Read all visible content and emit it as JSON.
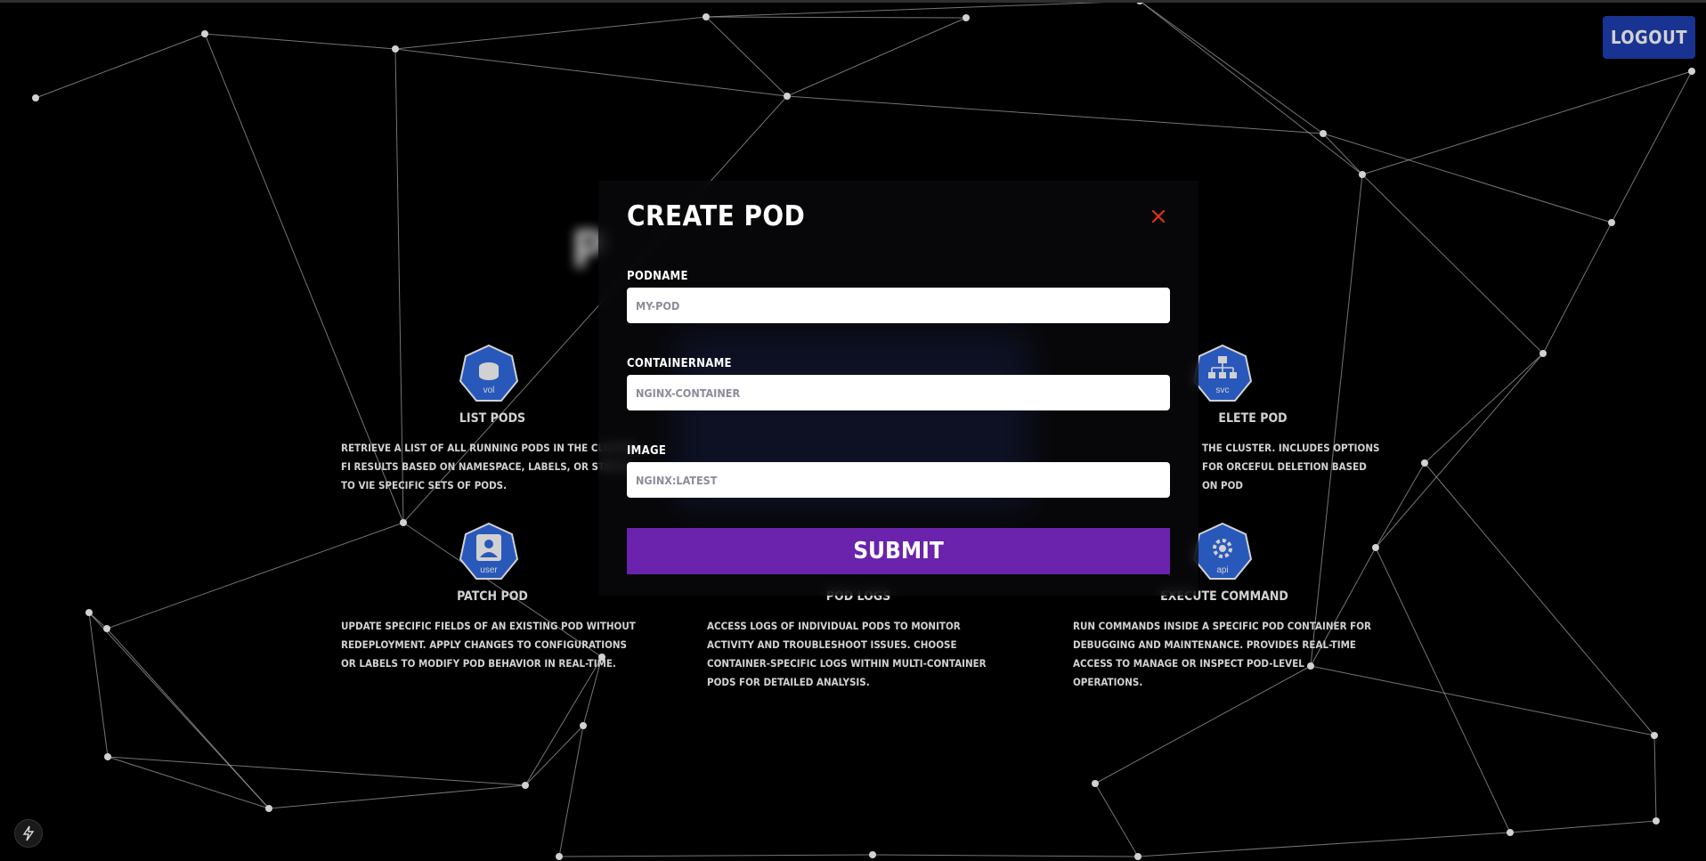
{
  "header": {
    "logout_label": "LOGOUT"
  },
  "page": {
    "title_visible_char": "P"
  },
  "cards": [
    {
      "icon": "volume-icon",
      "icon_text": "vol",
      "title": "LIST PODS",
      "desc": "RETRIEVE A LIST OF ALL RUNNING PODS IN THE CLUSTER. FI RESULTS BASED ON NAMESPACE, LABELS, OR STATUS TO VIE SPECIFIC SETS OF PODS."
    },
    {
      "icon": "service-icon",
      "icon_text": "svc",
      "title": "ELETE POD",
      "desc": "THE CLUSTER. INCLUDES OPTIONS FOR ORCEFUL DELETION BASED ON POD"
    },
    {
      "icon": "user-icon",
      "icon_text": "user",
      "title": "PATCH POD",
      "desc": "UPDATE SPECIFIC FIELDS OF AN EXISTING POD WITHOUT REDEPLOYMENT. APPLY CHANGES TO CONFIGURATIONS OR LABELS TO MODIFY POD BEHAVIOR IN REAL-TIME."
    },
    {
      "icon": "pod-icon",
      "icon_text": "",
      "title": "POD LOGS",
      "desc": "ACCESS LOGS OF INDIVIDUAL PODS TO MONITOR ACTIVITY AND TROUBLESHOOT ISSUES. CHOOSE CONTAINER-SPECIFIC LOGS WITHIN MULTI-CONTAINER PODS FOR DETAILED ANALYSIS."
    },
    {
      "icon": "api-icon",
      "icon_text": "api",
      "title": "EXECUTE COMMAND",
      "desc": "RUN COMMANDS INSIDE A SPECIFIC POD CONTAINER FOR DEBUGGING AND MAINTENANCE. PROVIDES REAL-TIME ACCESS TO MANAGE OR INSPECT POD-LEVEL OPERATIONS."
    }
  ],
  "modal": {
    "title": "CREATE POD",
    "fields": [
      {
        "label": "PODNAME",
        "placeholder": "MY-POD"
      },
      {
        "label": "CONTAINERNAME",
        "placeholder": "NGINX-CONTAINER"
      },
      {
        "label": "IMAGE",
        "placeholder": "NGINX:LATEST"
      }
    ],
    "submit_label": "SUBMIT"
  },
  "colors": {
    "accent_blue": "#1f3fb3",
    "submit_purple": "#6b22ad",
    "close_red": "#e0301e",
    "k8s_blue": "#326ce5"
  }
}
